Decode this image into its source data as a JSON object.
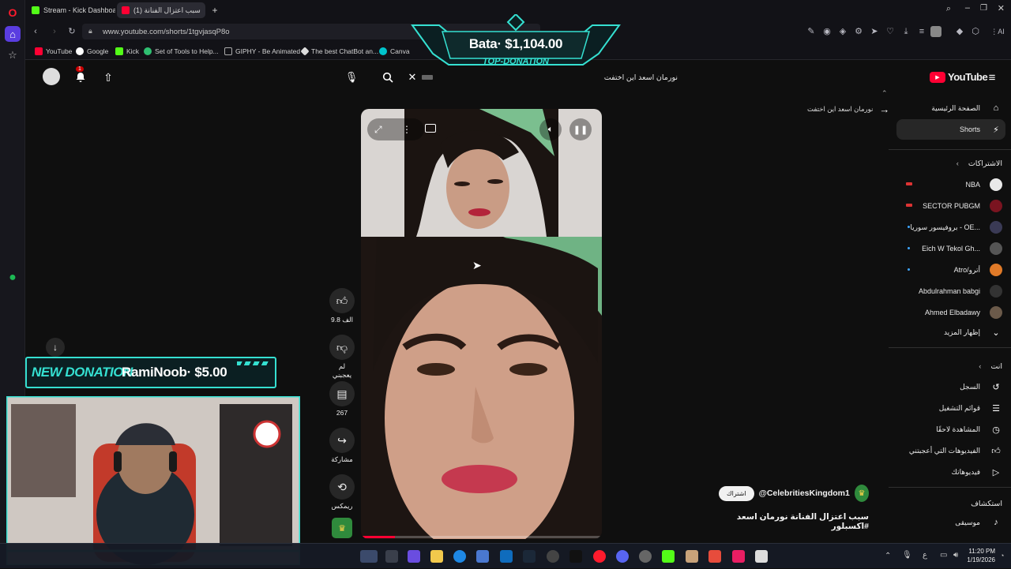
{
  "colors": {
    "yt_red": "#ff0033",
    "accent_teal": "#35e0d1",
    "opera_red": "#ff1b2d",
    "spotify_green": "#1db954"
  },
  "tabs": [
    {
      "label": "Stream - Kick Dashboard",
      "favicon": "kick-icon",
      "active": false
    },
    {
      "label": "(1) سبب اعتزال الفنانة",
      "favicon": "youtube-icon",
      "active": true
    }
  ],
  "address": {
    "url": "www.youtube.com/shorts/1tgvjasqP8o"
  },
  "bookmarks": [
    {
      "label": "YouTube",
      "icon": "youtube-icon"
    },
    {
      "label": "Google",
      "icon": "google-icon"
    },
    {
      "label": "Kick",
      "icon": "kick-icon"
    },
    {
      "label": "Set of Tools to Help...",
      "icon": "tools-icon"
    },
    {
      "label": "GIPHY - Be Animated",
      "icon": "giphy-icon"
    },
    {
      "label": "The best ChatBot an...",
      "icon": "chatbot-icon"
    },
    {
      "label": "Canva",
      "icon": "canva-icon"
    }
  ],
  "top_donation": {
    "text": "Bata· $1,104.00",
    "label": "TOP-DONATION"
  },
  "new_donation": {
    "label": "NEW DONATION",
    "donor": "RamiNoob· $5.00"
  },
  "youtube": {
    "logo_text": "YouTube",
    "search_query": "نورمان اسعد اين اختفت",
    "notification_count": "1",
    "back_link": "نورمان اسعد اين اختفت"
  },
  "actions": [
    {
      "name": "like",
      "label": "9.8 الف",
      "icon": "thumbs-up-icon"
    },
    {
      "name": "dislike",
      "label": "لم يعجبني",
      "icon": "thumbs-down-icon"
    },
    {
      "name": "comments",
      "label": "267",
      "icon": "comment-icon"
    },
    {
      "name": "share",
      "label": "مشاركة",
      "icon": "share-icon"
    },
    {
      "name": "remix",
      "label": "ريمكس",
      "icon": "remix-icon"
    }
  ],
  "video": {
    "channel": "@CelebritiesKingdom1",
    "subscribe_label": "اشتراك",
    "title": "سبب اعتزال الفنانة نورمان اسعد #اكسبلور"
  },
  "sidebar": {
    "main": [
      {
        "label": "الصفحة الرئيسية",
        "icon": "home-icon"
      },
      {
        "label": "Shorts",
        "icon": "shorts-icon",
        "active": true
      }
    ],
    "subscriptions_title": "الاشتراكات",
    "subscriptions": [
      {
        "label": "NBA",
        "live": true,
        "avatar": "#e8e8e8"
      },
      {
        "label": "SECTOR PUBGM",
        "live": true,
        "avatar": "#7a1420"
      },
      {
        "label": "بروفيسور سوريا - OE...",
        "live": false,
        "dot": true,
        "avatar": "#3a3a55"
      },
      {
        "label": "Eich W Tekol Gh...",
        "live": false,
        "dot": true,
        "avatar": "#555"
      },
      {
        "label": "Atro/أترو",
        "live": false,
        "dot": true,
        "avatar": "#e07a28"
      },
      {
        "label": "Abdulrahman babgi",
        "live": false,
        "avatar": "#333"
      },
      {
        "label": "Ahmed Elbadawy",
        "live": false,
        "avatar": "#6b5a4a"
      }
    ],
    "show_more": "إظهار المزيد",
    "you_title": "انت",
    "you_items": [
      {
        "label": "السجل",
        "icon": "history-icon"
      },
      {
        "label": "قوائم التشغيل",
        "icon": "playlist-icon"
      },
      {
        "label": "المشاهدة لاحقًا",
        "icon": "clock-icon"
      },
      {
        "label": "الفيديوهات التي أعجبتني",
        "icon": "thumbs-up-icon"
      },
      {
        "label": "فيديوهاتك",
        "icon": "play-icon"
      }
    ],
    "explore_title": "استكشاف",
    "explore_items": [
      {
        "label": "موسيقى",
        "icon": "music-icon"
      }
    ]
  },
  "taskbar": {
    "time": "11:20 PM",
    "date": "1/19/2026"
  }
}
